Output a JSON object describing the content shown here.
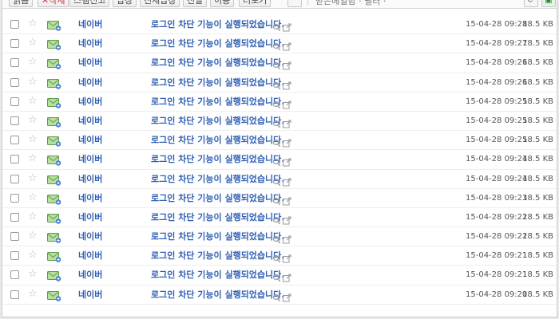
{
  "toolbar": {
    "buttons": [
      {
        "id": "read",
        "label": "읽음"
      },
      {
        "id": "delete",
        "label": "✕삭제"
      },
      {
        "id": "spam",
        "label": "스팸신고"
      },
      {
        "id": "reply",
        "label": "답장"
      },
      {
        "id": "reply_all",
        "label": "전체답장"
      },
      {
        "id": "forward",
        "label": "전달"
      },
      {
        "id": "move",
        "label": "이동"
      },
      {
        "id": "more",
        "label": "더보기"
      }
    ],
    "filter_text": "받은메일함 · 필터 ·",
    "refresh_icon": "refresh-icon",
    "green_icon": "app-icon"
  },
  "icons": {
    "star": "star-icon",
    "mail": "mail-open-icon",
    "search": "search-icon",
    "popup": "open-window-icon"
  },
  "colors": {
    "link_blue": "#2f5fb3",
    "text_gray": "#555555"
  },
  "emails": [
    {
      "sender": "네이버",
      "subject": "로그인 차단 기능이 실행되었습니다.",
      "date": "15-04-28 09:28",
      "size": "18.5 KB"
    },
    {
      "sender": "네이버",
      "subject": "로그인 차단 기능이 실행되었습니다.",
      "date": "15-04-28 09:27",
      "size": "18.5 KB"
    },
    {
      "sender": "네이버",
      "subject": "로그인 차단 기능이 실행되었습니다.",
      "date": "15-04-28 09:26",
      "size": "18.5 KB"
    },
    {
      "sender": "네이버",
      "subject": "로그인 차단 기능이 실행되었습니다.",
      "date": "15-04-28 09:26",
      "size": "18.5 KB"
    },
    {
      "sender": "네이버",
      "subject": "로그인 차단 기능이 실행되었습니다.",
      "date": "15-04-28 09:25",
      "size": "18.5 KB"
    },
    {
      "sender": "네이버",
      "subject": "로그인 차단 기능이 실행되었습니다.",
      "date": "15-04-28 09:25",
      "size": "18.5 KB"
    },
    {
      "sender": "네이버",
      "subject": "로그인 차단 기능이 실행되었습니다.",
      "date": "15-04-28 09:25",
      "size": "18.5 KB"
    },
    {
      "sender": "네이버",
      "subject": "로그인 차단 기능이 실행되었습니다.",
      "date": "15-04-28 09:24",
      "size": "18.5 KB"
    },
    {
      "sender": "네이버",
      "subject": "로그인 차단 기능이 실행되었습니다.",
      "date": "15-04-28 09:24",
      "size": "18.5 KB"
    },
    {
      "sender": "네이버",
      "subject": "로그인 차단 기능이 실행되었습니다.",
      "date": "15-04-28 09:23",
      "size": "18.5 KB"
    },
    {
      "sender": "네이버",
      "subject": "로그인 차단 기능이 실행되었습니다.",
      "date": "15-04-28 09:22",
      "size": "18.5 KB"
    },
    {
      "sender": "네이버",
      "subject": "로그인 차단 기능이 실행되었습니다.",
      "date": "15-04-28 09:22",
      "size": "18.5 KB"
    },
    {
      "sender": "네이버",
      "subject": "로그인 차단 기능이 실행되었습니다.",
      "date": "15-04-28 09:21",
      "size": "18.5 KB"
    },
    {
      "sender": "네이버",
      "subject": "로그인 차단 기능이 실행되었습니다.",
      "date": "15-04-28 09:21",
      "size": "18.5 KB"
    },
    {
      "sender": "네이버",
      "subject": "로그인 차단 기능이 실행되었습니다.",
      "date": "15-04-28 09:20",
      "size": "18.5 KB"
    }
  ]
}
